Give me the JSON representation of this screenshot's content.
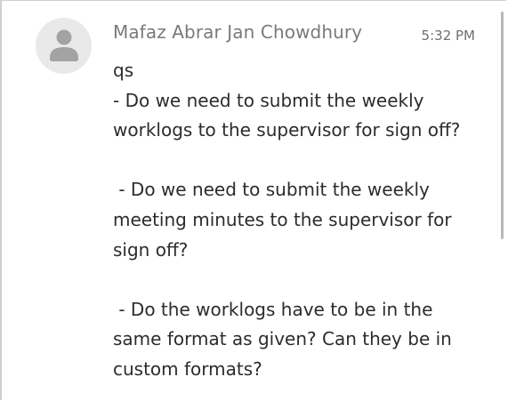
{
  "message": {
    "sender": "Mafaz Abrar Jan Chowdhury",
    "time": "5:32 PM",
    "avatar_icon": "user-icon",
    "body": "qs\n- Do we need to submit the weekly worklogs to the supervisor for sign off?\n\n - Do we need to submit the weekly meeting minutes to the supervisor for sign off?\n\n - Do the worklogs have to be in the same format as given? Can they be in custom formats?"
  },
  "colors": {
    "avatar_bg": "#e9e9e9",
    "avatar_icon": "#a3a3a3",
    "sender_text": "#7a7a7a",
    "body_text": "#2c2c2c"
  }
}
